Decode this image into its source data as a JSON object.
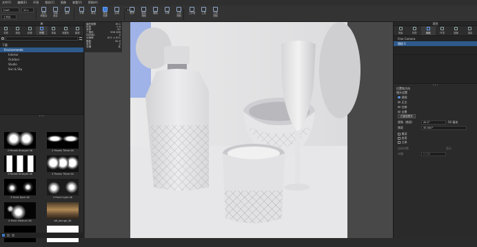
{
  "menu": [
    "文件(F)",
    "编辑(E)",
    "环境",
    "相机(C)",
    "图像",
    "查看(V)",
    "帮助(H)"
  ],
  "toolbar": {
    "render_mode": "Draft",
    "render_quality": "50 ▸",
    "mode_label": "工作区",
    "slider_value": "90.0",
    "buttons": [
      {
        "label": "材质\n球组合"
      },
      {
        "label": "动画\n组合"
      },
      {
        "label": "旋转"
      },
      {
        "label": "平移"
      },
      {
        "label": "推拉"
      },
      {
        "label": "渲染\n设置"
      },
      {
        "label": "区域"
      },
      {
        "label": "暂停"
      },
      {
        "label": "相机\n视图"
      },
      {
        "label": "截图"
      },
      {
        "label": "平移"
      },
      {
        "label": "几何\n视图"
      },
      {
        "label": "工作室"
      },
      {
        "label": "工具"
      },
      {
        "label": "几何\n视图"
      }
    ]
  },
  "left_panel": {
    "title": "库",
    "tabs": [
      "材质",
      "颜色",
      "纹理",
      "环境",
      "背景",
      "收藏夹",
      "模型"
    ],
    "active_tab": 3,
    "tree": {
      "root": "下载",
      "items": [
        "Environments",
        "Interior",
        "Outdoor",
        "Studio",
        "Sun & Sky"
      ],
      "selected": 0
    },
    "thumbnails": [
      {
        "label": "2 Panels Straight 4K",
        "style": "two-panels"
      },
      {
        "label": "2 Panels Tilted 4K",
        "style": "two-tilted"
      },
      {
        "label": "3 Panels Straight 4K",
        "style": "three-panels"
      },
      {
        "label": "3 Panels Tilted 4K",
        "style": "three-tilted"
      },
      {
        "label": "3 Point Dark 4K",
        "style": "point-dark"
      },
      {
        "label": "3 Point Light 4K",
        "style": "point-light"
      },
      {
        "label": "4 Point Medium 4K",
        "style": "point-medium"
      },
      {
        "label": "aft_lounge_4K",
        "style": "lounge"
      },
      {
        "label": "",
        "style": "black"
      },
      {
        "label": "",
        "style": "white"
      }
    ]
  },
  "stats": [
    {
      "k": "每秒帧数",
      "v": "16.1"
    },
    {
      "k": "时间",
      "v": "0.0"
    },
    {
      "k": "采样",
      "v": "67"
    },
    {
      "k": "三角形",
      "v": "596 289"
    },
    {
      "k": "NURBS",
      "v": "0"
    },
    {
      "k": "分辨率",
      "v": "671 × 671"
    },
    {
      "k": "焦距",
      "v": "50.0"
    },
    {
      "k": "发光",
      "v": "0"
    },
    {
      "k": "去噪",
      "v": "关"
    }
  ],
  "right_panel": {
    "title": "项目",
    "tabs": [
      "场景",
      "材质",
      "相机",
      "环境",
      "图像",
      "渲染"
    ],
    "active_tab": 2,
    "camera_list": [
      "Free Camera",
      "相机 1"
    ],
    "camera_selected": 1,
    "sections": [
      "位置和方向",
      "镜头设置"
    ],
    "projection": [
      {
        "label": "透视",
        "on": true
      },
      {
        "label": "正交",
        "on": false
      },
      {
        "label": "位移",
        "on": false
      },
      {
        "label": "全景",
        "on": false
      }
    ],
    "lock_button": "已锁定镜头",
    "fov_label": "视角（焦距）",
    "fov_value": "49.2°",
    "fov_extra": "50 毫米",
    "focal_label": "焦距",
    "focal_value": "35.000°",
    "dof_label": "景深",
    "dof_checkbox": "启用",
    "focus_label": "自动对焦",
    "focus_extra": "显示",
    "aperture_label": "光圈",
    "aperture_value": "0.000",
    "stereo_label": "立体"
  },
  "colors": {
    "accent": "#3a7bd5",
    "selection": "#2e5a8c",
    "viewport_bg": "#4a4a4a"
  }
}
